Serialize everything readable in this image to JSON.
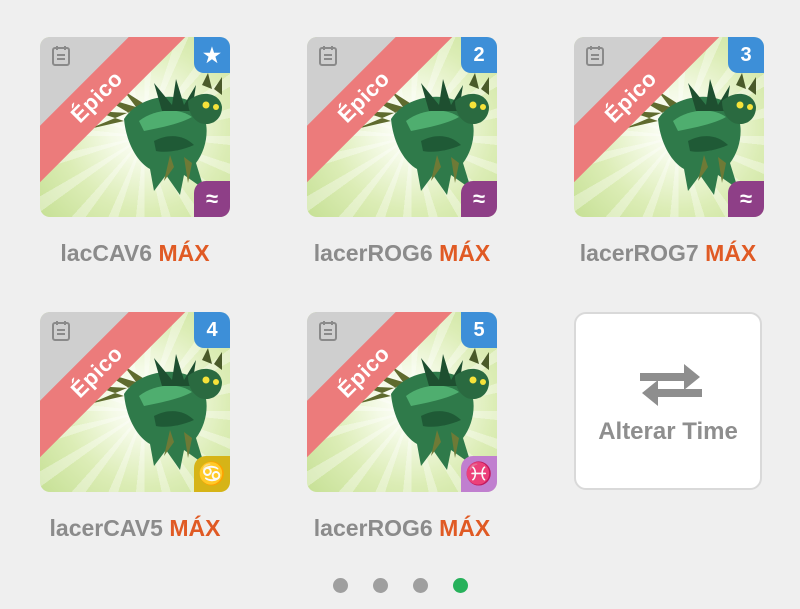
{
  "cards": [
    {
      "name": "lacCAV6",
      "level": "MÁX",
      "rarity": "Épico",
      "rank": "★",
      "rank_icon": "star-icon",
      "element_symbol": "≈",
      "element_icon": "water-waves-icon",
      "element_color": "#8e3f87"
    },
    {
      "name": "lacerROG6",
      "level": "MÁX",
      "rarity": "Épico",
      "rank": "2",
      "rank_icon": "number-badge",
      "element_symbol": "≈",
      "element_icon": "water-waves-icon",
      "element_color": "#8e3f87"
    },
    {
      "name": "lacerROG7",
      "level": "MÁX",
      "rarity": "Épico",
      "rank": "3",
      "rank_icon": "number-badge",
      "element_symbol": "≈",
      "element_icon": "water-waves-icon",
      "element_color": "#8e3f87"
    },
    {
      "name": "lacerCAV5",
      "level": "MÁX",
      "rarity": "Épico",
      "rank": "4",
      "rank_icon": "number-badge",
      "element_symbol": "♋",
      "element_icon": "cancer-icon",
      "element_color": "#d6b417"
    },
    {
      "name": "lacerROG6",
      "level": "MÁX",
      "rarity": "Épico",
      "rank": "5",
      "rank_icon": "number-badge",
      "element_symbol": "♓",
      "element_icon": "pisces-icon",
      "element_color": "#c07fcf"
    }
  ],
  "swap": {
    "label": "Alterar Time",
    "icon": "swap-arrows-icon"
  },
  "pagination": {
    "pages": 4,
    "active_page": 4
  },
  "colors": {
    "rarity_ribbon": "#ec7b7b",
    "rank_badge": "#3d8fd8",
    "max_text": "#e05a24",
    "active_dot": "#27b15b"
  }
}
